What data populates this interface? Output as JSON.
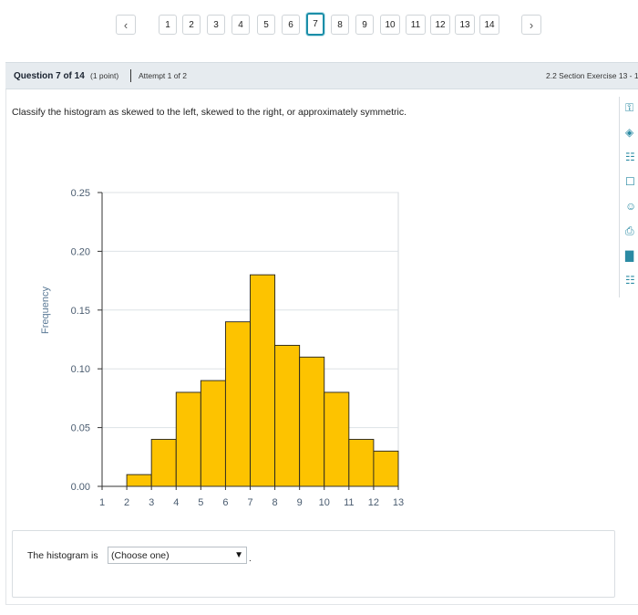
{
  "pager": {
    "prev_icon": "chevron-left-icon",
    "next_icon": "chevron-right-icon",
    "pages": [
      "1",
      "2",
      "3",
      "4",
      "5",
      "6",
      "7",
      "8",
      "9",
      "10",
      "11",
      "12",
      "13",
      "14"
    ],
    "active_page": "7"
  },
  "question_bar": {
    "number": "Question 7 of 14",
    "points": "(1 point)",
    "attempt": "Attempt 1 of 2",
    "section": "2.2 Section Exercise 13 - 1"
  },
  "prompt": "Classify the histogram as skewed to the left, skewed to the right, or approximately symmetric.",
  "side_tools": [
    "key-icon",
    "tag-icon",
    "notes-icon",
    "presentation-icon",
    "person-search-icon",
    "print-icon",
    "bar-chart-icon",
    "calculator-icon"
  ],
  "chart_data": {
    "type": "bar",
    "bins": [
      [
        2,
        3
      ],
      [
        3,
        4
      ],
      [
        4,
        5
      ],
      [
        5,
        6
      ],
      [
        6,
        7
      ],
      [
        7,
        8
      ],
      [
        8,
        9
      ],
      [
        9,
        10
      ],
      [
        10,
        11
      ],
      [
        11,
        12
      ]
    ],
    "values": [
      0.01,
      0.04,
      0.08,
      0.09,
      0.14,
      0.18,
      0.12,
      0.11,
      0.08,
      0.04,
      0.03
    ],
    "edges": [
      2,
      3,
      4,
      5,
      6,
      7,
      8,
      9,
      10,
      11,
      12,
      13
    ],
    "xticks": [
      "1",
      "2",
      "3",
      "4",
      "5",
      "6",
      "7",
      "8",
      "9",
      "10",
      "11",
      "12",
      "13"
    ],
    "yticks": [
      "0.00",
      "0.05",
      "0.10",
      "0.15",
      "0.20",
      "0.25"
    ],
    "ylabel": "Frequency",
    "xlim": [
      1,
      13
    ],
    "ylim": [
      0,
      0.25
    ],
    "grid": true,
    "bar_color": "#fdc300",
    "bar_edge": "#222222"
  },
  "answer": {
    "lead": "The histogram is",
    "select_value": "(Choose one)",
    "trailing": "."
  },
  "colors": {
    "accent": "#1b8ea8",
    "bar": "#fdc300"
  }
}
